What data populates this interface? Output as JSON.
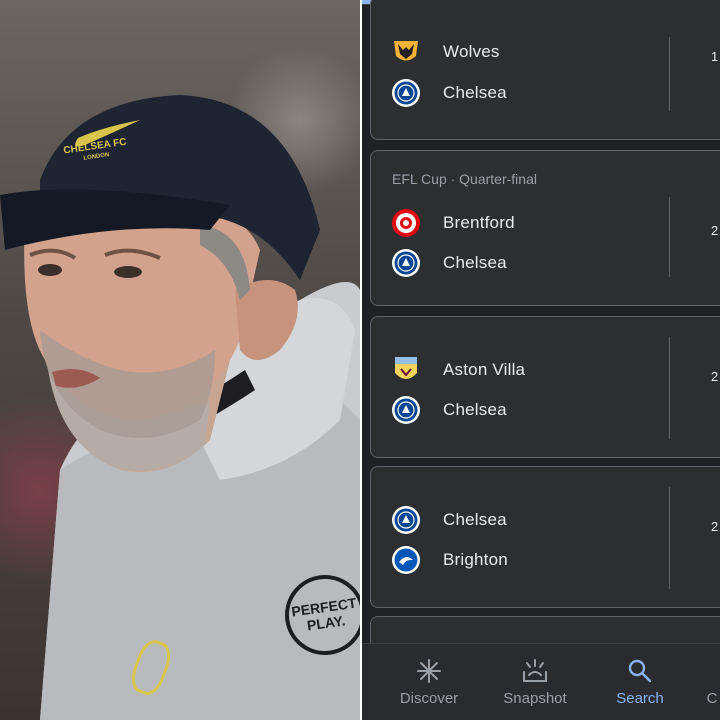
{
  "photo": {
    "cap_text_line1": "CHELSEA FC",
    "cap_text_line2": "LONDON",
    "jacket_badge_line1": "PERFECT",
    "jacket_badge_line2": "PLAY."
  },
  "matches": [
    {
      "stage": "",
      "teams": [
        {
          "name": "Wolves",
          "logo": "wolves-crest"
        },
        {
          "name": "Chelsea",
          "logo": "chelsea-crest"
        }
      ],
      "score_hint": "1"
    },
    {
      "stage": "EFL Cup · Quarter-final",
      "teams": [
        {
          "name": "Brentford",
          "logo": "brentford-crest"
        },
        {
          "name": "Chelsea",
          "logo": "chelsea-crest"
        }
      ],
      "score_hint": "2"
    },
    {
      "stage": "",
      "teams": [
        {
          "name": "Aston Villa",
          "logo": "aston-villa-crest"
        },
        {
          "name": "Chelsea",
          "logo": "chelsea-crest"
        }
      ],
      "score_hint": "2"
    },
    {
      "stage": "",
      "teams": [
        {
          "name": "Chelsea",
          "logo": "chelsea-crest"
        },
        {
          "name": "Brighton",
          "logo": "brighton-crest"
        }
      ],
      "score_hint": "2"
    }
  ],
  "nav": {
    "items": [
      {
        "label": "Discover",
        "icon": "asterisk-icon"
      },
      {
        "label": "Snapshot",
        "icon": "snapshot-icon"
      },
      {
        "label": "Search",
        "icon": "search-icon",
        "active": true
      },
      {
        "label": "C",
        "icon": "collections-icon"
      }
    ]
  },
  "colors": {
    "background": "#202124",
    "card": "#2d2e30",
    "accent": "#8ab4f8",
    "text": "#e8eaed",
    "muted": "#9aa0a6"
  }
}
